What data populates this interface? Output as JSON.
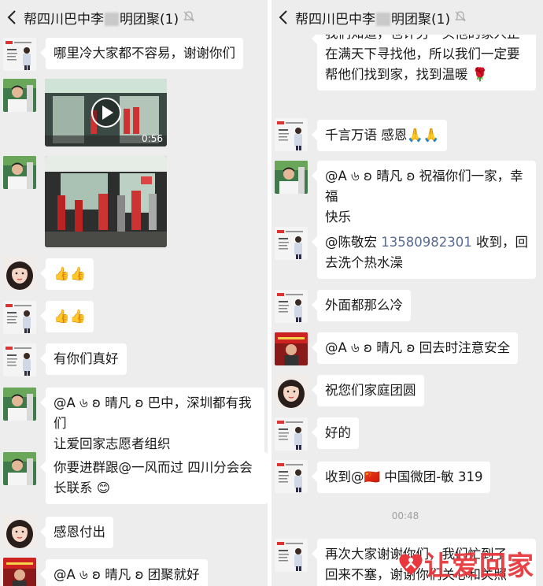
{
  "chat_title_prefix": "帮四川巴中李",
  "chat_title_suffix": "明团聚(1)",
  "colors": {
    "bubble": "#ffffff",
    "background": "#ededed",
    "link": "#576b95",
    "watermark": "#e8383d"
  },
  "left_messages": {
    "m0": "哪里冷大家都不容易，谢谢你们",
    "m1_duration": "0:56",
    "m3": "👍👍",
    "m4": "👍👍",
    "m5": "有你们真好",
    "m6a": "@A ৬ ʚ 晴凡 ʚ 巴中，深圳都有我们",
    "m6b": "让爱回家志愿者组织",
    "m7a": "你要进群跟@一风而过 四川分会会",
    "m7b": "长联系 😊",
    "m8": "感恩付出",
    "m9": "@A ৬ ʚ 晴凡 ʚ 团聚就好"
  },
  "right_messages": {
    "r0a": "我们知道，也许另一头他的家人正",
    "r0b": "在满天下寻找他，所以我们一定要",
    "r0c": "帮他们找到家，找到温暖 🌹",
    "r1": "千言万语 感恩🙏🙏",
    "r2a": "@A ৬ ʚ 晴凡 ʚ 祝福你们一家，幸福",
    "r2b": "快乐",
    "r3_prefix": "@陈敬宏 ",
    "r3_phone": "13580982301",
    "r3_suffix": " 收到，回",
    "r3b": "去洗个热水澡",
    "r4": "外面都那么冷",
    "r5": "@A ৬ ʚ 晴凡 ʚ 回去时注意安全",
    "r6": "祝您们家庭团圆",
    "r7": "好的",
    "r8": "收到@🇨🇳 中国微团-敏 319",
    "timestamp": "00:48",
    "r9a": "再次大家谢谢你们，我们忙到了",
    "r9b": "回来不塞，谢谢你们关心和关照"
  },
  "watermark": {
    "text": "让爱回家"
  }
}
